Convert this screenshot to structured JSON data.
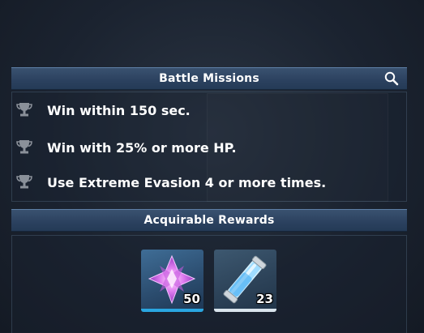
{
  "missions_header": {
    "title": "Battle Missions",
    "search_icon": "magnifier-icon"
  },
  "missions": [
    {
      "text": "Win within 150 sec.",
      "icon": "trophy-icon"
    },
    {
      "text": "Win with 25% or more HP.",
      "icon": "trophy-icon"
    },
    {
      "text": "Use Extreme Evasion 4 or more times.",
      "icon": "trophy-icon"
    }
  ],
  "rewards_header": {
    "title": "Acquirable Rewards"
  },
  "rewards": [
    {
      "item": "purple-crystal-icon",
      "quantity": "50",
      "frame_color": "#2aa6e0"
    },
    {
      "item": "blue-energy-tube-icon",
      "quantity": "23",
      "frame_color": "#d9e4ec"
    }
  ]
}
